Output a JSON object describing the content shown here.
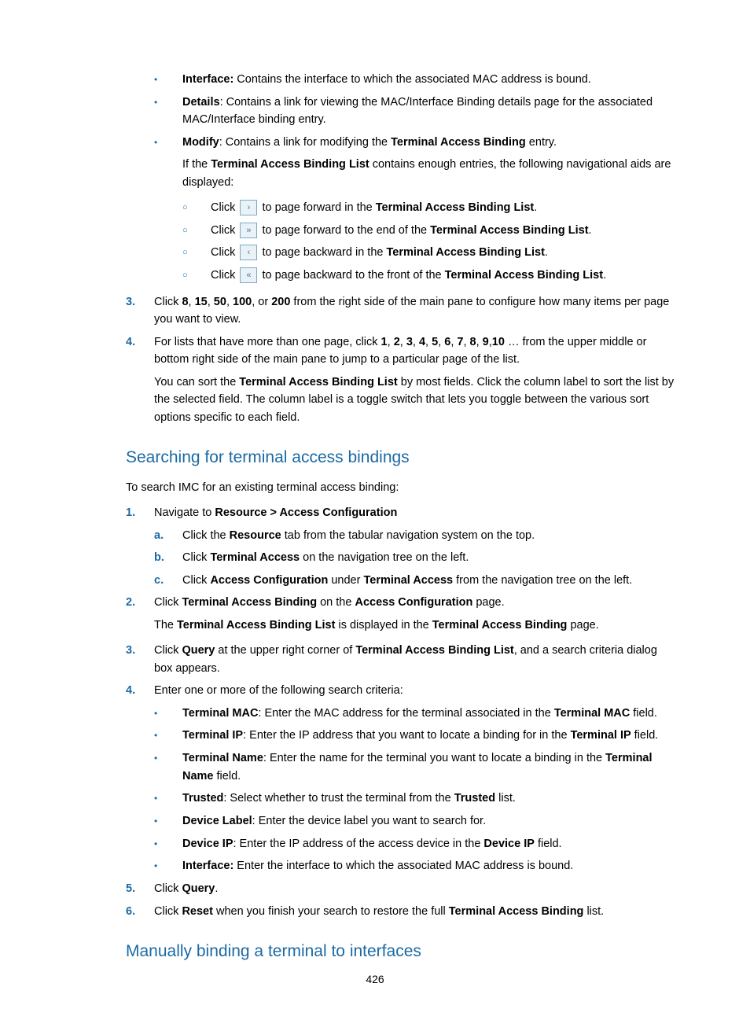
{
  "list1": {
    "interface": {
      "label": "Interface:",
      "text": " Contains the interface to which the associated MAC address is bound."
    },
    "details": {
      "label": "Details",
      "text": ": Contains a link for viewing the MAC/Interface Binding details page for the associated MAC/Interface binding entry."
    },
    "modify": {
      "label": "Modify",
      "text": ": Contains a link for modifying the ",
      "bold1": "Terminal Access Binding",
      "text2": " entry."
    },
    "modify_cont": {
      "pre": "If the ",
      "bold1": "Terminal Access Binding List",
      "post": " contains enough entries, the following navigational aids are displayed:"
    },
    "nav": {
      "a": {
        "pre": "Click ",
        "post": " to page forward in the ",
        "bold": "Terminal Access Binding List",
        "end": "."
      },
      "b": {
        "pre": "Click ",
        "post": " to page forward to the end of the ",
        "bold": "Terminal Access Binding List",
        "end": "."
      },
      "c": {
        "pre": "Click ",
        "post": " to page backward in the ",
        "bold": "Terminal Access Binding List",
        "end": "."
      },
      "d": {
        "pre": "Click ",
        "post": " to page backward to the front of the ",
        "bold": "Terminal Access Binding List",
        "end": "."
      }
    },
    "step3": {
      "num": "3.",
      "pre": "Click ",
      "b1": "8",
      "s1": ", ",
      "b2": "15",
      "s2": ", ",
      "b3": "50",
      "s3": ", ",
      "b4": "100",
      "s4": ", or ",
      "b5": "200",
      "post": " from the right side of the main pane to configure how many items per page you want to view."
    },
    "step4": {
      "num": "4.",
      "pre": "For lists that have more than one page, click ",
      "b1": "1",
      "s1": ", ",
      "b2": "2",
      "s2": ", ",
      "b3": "3",
      "s3": ", ",
      "b4": "4",
      "s4": ", ",
      "b5": "5",
      "s5": ", ",
      "b6": "6",
      "s6": ", ",
      "b7": "7",
      "s7": ", ",
      "b8": "8",
      "s8": ", ",
      "b9": "9",
      "s9": ",",
      "b10": "10",
      "post": " … from the upper middle or bottom right side of the main pane to jump to a particular page of the list."
    },
    "step4_cont": {
      "pre": "You can sort the ",
      "bold1": "Terminal Access Binding List",
      "post": " by most fields. Click the column label to sort the list by the selected field. The column label is a toggle switch that lets you toggle between the various sort options specific to each field."
    }
  },
  "heading1": "Searching for terminal access bindings",
  "intro1": "To search IMC for an existing terminal access binding:",
  "steps2": {
    "s1": {
      "num": "1.",
      "pre": "Navigate to ",
      "bold": "Resource > Access Configuration"
    },
    "s1a": {
      "alpha": "a.",
      "pre": "Click the ",
      "bold": "Resource",
      "post": " tab from the tabular navigation system on the top."
    },
    "s1b": {
      "alpha": "b.",
      "pre": "Click ",
      "bold": "Terminal Access",
      "post": " on the navigation tree on the left."
    },
    "s1c": {
      "alpha": "c.",
      "pre": "Click ",
      "bold": "Access Configuration",
      "mid": " under ",
      "bold2": "Terminal Access",
      "post": " from the navigation tree on the left."
    },
    "s2": {
      "num": "2.",
      "pre": "Click ",
      "bold": "Terminal Access Binding",
      "mid": " on the ",
      "bold2": "Access Configuration",
      "post": " page."
    },
    "s2_cont": {
      "pre": "The ",
      "bold1": "Terminal Access Binding List",
      "mid": " is displayed in the ",
      "bold2": "Terminal Access Binding",
      "post": " page."
    },
    "s3": {
      "num": "3.",
      "pre": "Click ",
      "bold": "Query",
      "mid": " at the upper right corner of ",
      "bold2": "Terminal Access Binding List",
      "post": ", and a search criteria dialog box appears."
    },
    "s4": {
      "num": "4.",
      "text": "Enter one or more of the following search criteria:"
    },
    "c_mac": {
      "label": "Terminal MAC",
      "pre": ": Enter the MAC address for the terminal associated in the ",
      "bold": "Terminal MAC",
      "post": " field."
    },
    "c_ip": {
      "label": "Terminal IP",
      "pre": ": Enter the IP address that you want to locate a binding for in the ",
      "bold": "Terminal IP",
      "post": " field."
    },
    "c_name": {
      "label": "Terminal Name",
      "pre": ": Enter the name for the terminal you want to locate a binding in the ",
      "bold": "Terminal Name",
      "post": " field."
    },
    "c_trusted": {
      "label": "Trusted",
      "pre": ": Select whether to trust the terminal from the ",
      "bold": "Trusted",
      "post": " list."
    },
    "c_devlabel": {
      "label": "Device Label",
      "text": ": Enter the device label you want to search for."
    },
    "c_devip": {
      "label": "Device IP",
      "pre": ": Enter the IP address of the access device in the ",
      "bold": "Device IP",
      "post": " field."
    },
    "c_iface": {
      "label": "Interface:",
      "text": " Enter the interface to which the associated MAC address is bound."
    },
    "s5": {
      "num": "5.",
      "pre": "Click ",
      "bold": "Query",
      "post": "."
    },
    "s6": {
      "num": "6.",
      "pre": "Click ",
      "bold": "Reset",
      "mid": " when you finish your search to restore the full ",
      "bold2": "Terminal Access Binding",
      "post": " list."
    }
  },
  "heading2": "Manually binding a terminal to interfaces",
  "pagenum": "426",
  "glyphs": {
    "next": "›",
    "last": "»",
    "prev": "‹",
    "first": "«",
    "dot": "•",
    "circ": "○"
  }
}
